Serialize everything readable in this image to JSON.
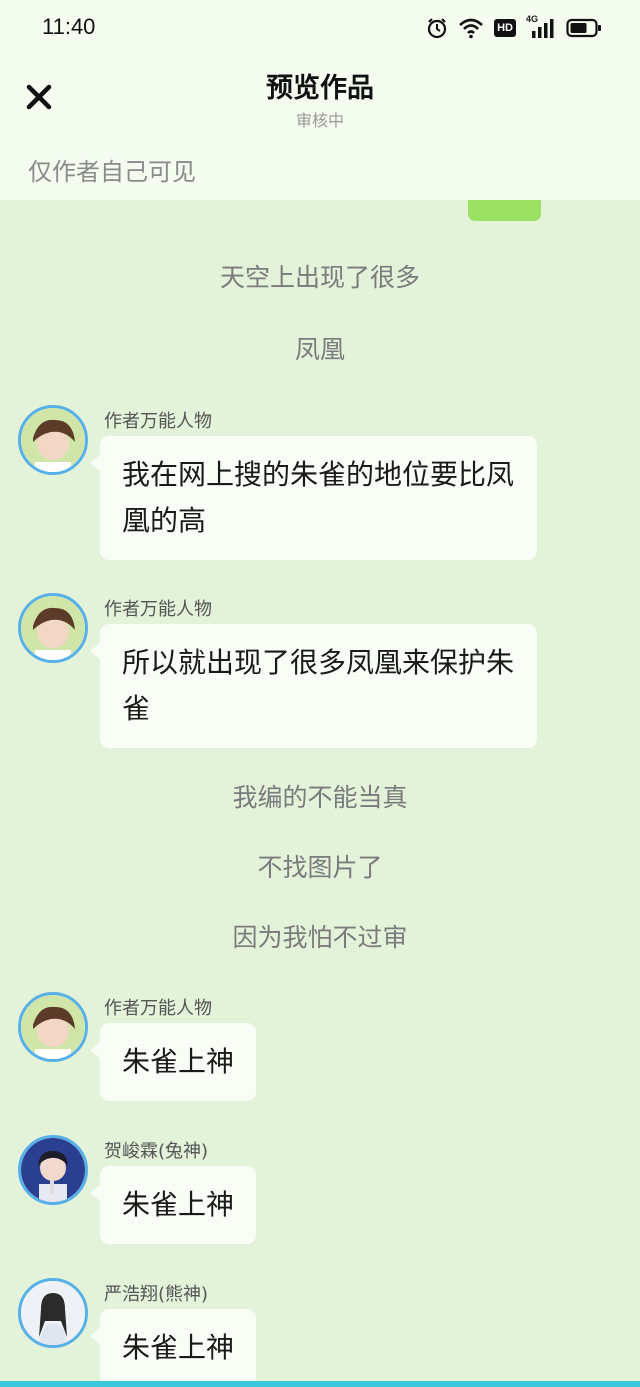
{
  "status_bar": {
    "time": "11:40",
    "icons": [
      "alarm-icon",
      "wifi-icon",
      "hd-icon",
      "signal-4g-icon",
      "battery-icon"
    ],
    "hd_label": "HD",
    "network_label": "4G"
  },
  "header": {
    "title": "预览作品",
    "subtitle": "审核中",
    "close_icon": "close-icon"
  },
  "visibility_note": "仅作者自己可见",
  "narration": {
    "n1": "天空上出现了很多",
    "n2": "凤凰",
    "n3": "我编的不能当真",
    "n4": "不找图片了",
    "n5": "因为我怕不过审"
  },
  "messages": [
    {
      "sender": "作者万能人物",
      "text": "我在网上搜的朱雀的地位要比凤凰的高"
    },
    {
      "sender": "作者万能人物",
      "text": "所以就出现了很多凤凰来保护朱雀"
    },
    {
      "sender": "作者万能人物",
      "text": "朱雀上神"
    },
    {
      "sender": "贺峻霖(兔神)",
      "text": "朱雀上神"
    },
    {
      "sender": "严浩翔(熊神)",
      "text": "朱雀上神"
    }
  ],
  "colors": {
    "page_background": "#e2f3da",
    "header_background": "#f4fcf0",
    "bubble_background": "#f8fdf5",
    "avatar_ring": "#58b0e8",
    "own_bubble": "#9be061"
  }
}
